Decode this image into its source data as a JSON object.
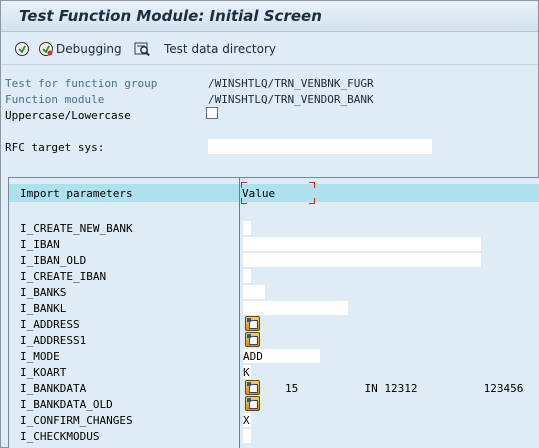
{
  "window": {
    "title": "Test Function Module: Initial Screen"
  },
  "toolbar": {
    "debugging_label": "Debugging",
    "test_data_dir_label": "Test data directory"
  },
  "header_fields": {
    "function_group_label": "Test for function group",
    "function_group_value": "/WINSHTLQ/TRN_VENBNK_FUGR",
    "function_module_label": "Function module",
    "function_module_value": "/WINSHTLQ/TRN_VENDOR_BANK",
    "uppercase_label": "Uppercase/Lowercase",
    "uppercase_checked": false,
    "rfc_label": "RFC target sys:",
    "rfc_value": ""
  },
  "table": {
    "col_param": "Import parameters",
    "col_value": "Value",
    "rows": [
      {
        "name": "I_CREATE_NEW_BANK",
        "value": ""
      },
      {
        "name": "I_IBAN",
        "value": ""
      },
      {
        "name": "I_IBAN_OLD",
        "value": ""
      },
      {
        "name": "I_CREATE_IBAN",
        "value": ""
      },
      {
        "name": "I_BANKS",
        "value": ""
      },
      {
        "name": "I_BANKL",
        "value": ""
      },
      {
        "name": "I_ADDRESS",
        "value": ""
      },
      {
        "name": "I_ADDRESS1",
        "value": ""
      },
      {
        "name": "I_MODE",
        "value": "ADD"
      },
      {
        "name": "I_KOART",
        "value": "K"
      },
      {
        "name": "I_BANKDATA",
        "value": "15          IN 12312          123456"
      },
      {
        "name": "I_BANKDATA_OLD",
        "value": ""
      },
      {
        "name": "I_CONFIRM_CHANGES",
        "value": "X"
      },
      {
        "name": "I_CHECKMODUS",
        "value": ""
      }
    ]
  },
  "icons": {
    "execute": "execute-icon",
    "debugging": "debugging-icon",
    "test_data_directory": "test-data-directory-icon",
    "structure": "structure-editor-icon"
  }
}
